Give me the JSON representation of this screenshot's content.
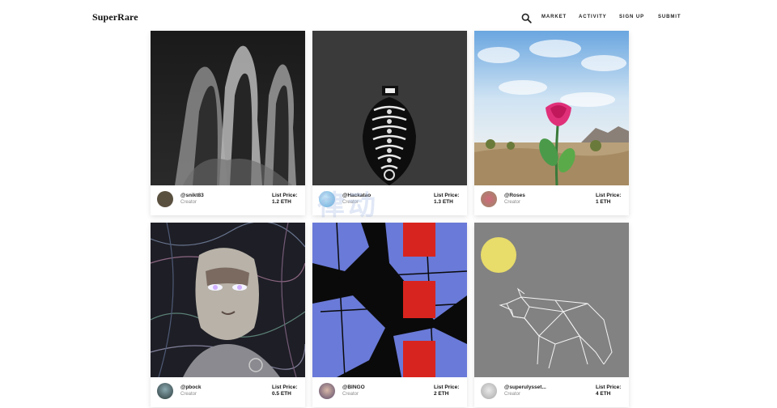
{
  "header": {
    "logo": "SuperRare",
    "nav": [
      {
        "id": "market",
        "label": "MARKET"
      },
      {
        "id": "activity",
        "label": "ACTIVITY"
      },
      {
        "id": "signup",
        "label": "SIGN UP"
      },
      {
        "id": "submit",
        "label": "SUBMIT"
      }
    ]
  },
  "cards": [
    {
      "handle": "@snikt83",
      "role": "Creator",
      "price_label": "List Price:",
      "price": "1.2 ETH",
      "artwork": "hooded-figures",
      "avatar_color": "#5a5040"
    },
    {
      "handle": "@Hackatao",
      "role": "Creator",
      "price_label": "List Price:",
      "price": "1.3 ETH",
      "artwork": "totem-skeleton",
      "avatar_color": "#8ec6e8"
    },
    {
      "handle": "@Roses",
      "role": "Creator",
      "price_label": "List Price:",
      "price": "1 ETH",
      "artwork": "desert-rose",
      "avatar_color": "#b08a7a"
    },
    {
      "handle": "@pbock",
      "role": "Creator",
      "price_label": "List Price:",
      "price": "0.5 ETH",
      "artwork": "glitch-portrait",
      "avatar_color": "#3a4a48"
    },
    {
      "handle": "@BINGO",
      "role": "Creator",
      "price_label": "List Price:",
      "price": "2 ETH",
      "artwork": "blue-red-collage",
      "avatar_color": "#7a6a8a"
    },
    {
      "handle": "@superulysset...",
      "role": "Creator",
      "price_label": "List Price:",
      "price": "4 ETH",
      "artwork": "polygon-wolf",
      "avatar_color": "#c8c8c8"
    }
  ],
  "watermark": "律动"
}
